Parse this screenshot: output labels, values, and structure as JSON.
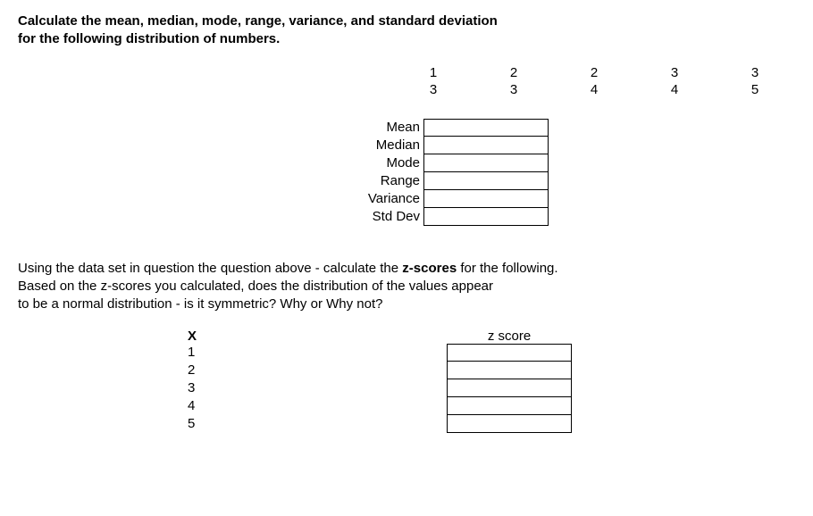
{
  "q1": {
    "line1": "Calculate the mean, median, mode, range, variance, and standard deviation",
    "line2": "for the following distribution of numbers.",
    "data_row1": [
      "1",
      "2",
      "2",
      "3",
      "3"
    ],
    "data_row2": [
      "3",
      "3",
      "4",
      "4",
      "5"
    ],
    "stats": [
      {
        "label": "Mean",
        "value": ""
      },
      {
        "label": "Median",
        "value": ""
      },
      {
        "label": "Mode",
        "value": ""
      },
      {
        "label": "Range",
        "value": ""
      },
      {
        "label": "Variance",
        "value": ""
      },
      {
        "label": "Std Dev",
        "value": ""
      }
    ]
  },
  "q2": {
    "line1_a": "Using the data set in question the question above - calculate the ",
    "line1_b": "z-scores",
    "line1_c": " for the following.",
    "line2": "Based on the z-scores you calculated, does the distribution of the values appear",
    "line3": "to be a normal distribution - is it symmetric?  Why or Why not?",
    "col_x": "X",
    "col_z": "z score",
    "rows": [
      {
        "x": "1",
        "z": ""
      },
      {
        "x": "2",
        "z": ""
      },
      {
        "x": "3",
        "z": ""
      },
      {
        "x": "4",
        "z": ""
      },
      {
        "x": "5",
        "z": ""
      }
    ]
  }
}
